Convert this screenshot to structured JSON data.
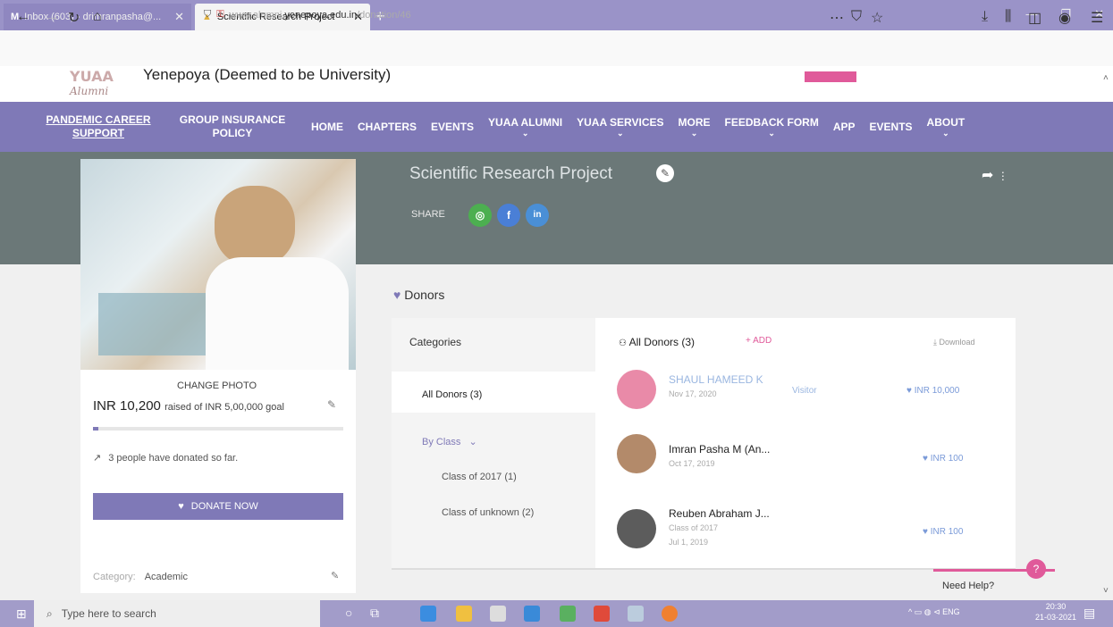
{
  "browser": {
    "tabs": [
      {
        "label": "Inbox (603) - drimranpasha@..."
      },
      {
        "label": "Scientific Research Project"
      }
    ],
    "url_prefix": "www.alumni.",
    "url_domain": "yenepoya.edu.in",
    "url_path": "/donation/46"
  },
  "site": {
    "university": "Yenepoya (Deemed to be University)",
    "logo_text": "Alumni",
    "menu": [
      {
        "label": "PANDEMIC CAREER SUPPORT",
        "dropdown": false
      },
      {
        "label": "GROUP INSURANCE POLICY",
        "dropdown": false
      },
      {
        "label": "HOME",
        "dropdown": false
      },
      {
        "label": "CHAPTERS",
        "dropdown": false
      },
      {
        "label": "EVENTS",
        "dropdown": false
      },
      {
        "label": "YUAA ALUMNI",
        "dropdown": true
      },
      {
        "label": "YUAA SERVICES",
        "dropdown": true
      },
      {
        "label": "MORE",
        "dropdown": true
      },
      {
        "label": "FEEDBACK FORM",
        "dropdown": true
      },
      {
        "label": "APP",
        "dropdown": false
      },
      {
        "label": "EVENTS",
        "dropdown": false
      },
      {
        "label": "ABOUT",
        "dropdown": true
      }
    ]
  },
  "project": {
    "title": "Scientific Research Project",
    "share_label": "SHARE",
    "change_photo": "CHANGE PHOTO",
    "raised_amount": "INR 10,200",
    "raised_suffix": "raised of INR 5,00,000 goal",
    "progress_fraction": 0.02,
    "donated_text": "3 people have donated so far.",
    "donate_button": "DONATE NOW",
    "category_label": "Category:",
    "category_value": "Academic"
  },
  "donors": {
    "heading": "Donors",
    "categories_title": "Categories",
    "all_donors_filter": "All Donors (3)",
    "by_class": "By Class",
    "classes": [
      "Class of 2017 (1)",
      "Class of unknown (2)"
    ],
    "list_title": "All Donors (3)",
    "add_label": "+ ADD",
    "download_label": "Download",
    "items": [
      {
        "name": "SHAUL HAMEED K",
        "class": "",
        "date": "Nov 17, 2020",
        "badge": "Visitor",
        "amount": "INR 10,000"
      },
      {
        "name": "Imran Pasha M (An...",
        "class": "",
        "date": "Oct 17, 2019",
        "badge": "",
        "amount": "INR 100"
      },
      {
        "name": "Reuben Abraham J...",
        "class": "Class of 2017",
        "date": "Jul 1, 2019",
        "badge": "",
        "amount": "INR 100"
      }
    ]
  },
  "help": {
    "label": "Need Help?"
  },
  "taskbar": {
    "search_placeholder": "Type here to search",
    "lang": "ENG",
    "time": "20:30",
    "date": "21-03-2021"
  }
}
